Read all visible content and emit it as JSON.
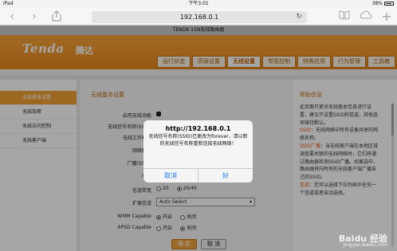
{
  "status_bar": {
    "carrier": "iPad",
    "time": "下午3:01",
    "battery": "38%"
  },
  "browser": {
    "url": "192.168.0.1"
  },
  "page_title": "TENDA 11N无线路由器",
  "header": {
    "logo": "Tenda",
    "logo_cn": "腾达",
    "nav_tabs": [
      "运行状态",
      "高级设置",
      "无线设置",
      "带宽控制",
      "特殊应用",
      "行为管理",
      "工具箱"
    ],
    "active_tab_index": 2
  },
  "sidebar": {
    "items": [
      {
        "label": "无线基本设置",
        "active": true
      },
      {
        "label": "无线加密",
        "active": false
      },
      {
        "label": "无线访问控制",
        "active": false
      },
      {
        "label": "无线客户端",
        "active": false
      }
    ]
  },
  "main": {
    "section_title": "无线基本设置",
    "labels": {
      "enable": "启用无线功能",
      "ssid": "无线信号名称(SSID)",
      "mode": "无线工作模式",
      "network_mode": "网络模式",
      "broadcast": "广播(SSID)",
      "channel": "信道",
      "bandwidth": "信道带宽",
      "ext_channel": "扩展信道",
      "wmm": "WMM Capable",
      "apsd": "APSD Capable"
    },
    "bandwidth_options": [
      "20",
      "20/40"
    ],
    "bandwidth_selected": "20/40",
    "ext_channel_value": "Auto Select",
    "wmm_options": [
      "开启",
      "关闭"
    ],
    "wmm_selected": "开启",
    "apsd_options": [
      "开启",
      "关闭"
    ],
    "apsd_selected": "关闭",
    "ok_button": "确 定",
    "cancel_button": "取 消"
  },
  "help": {
    "title": "帮助信息",
    "intro": "此页面只更对无线基本信息进行设置，建议只设置SSID和信道，其他选项保持默认。",
    "ssid_term": "SSID",
    "ssid_text": "：无线网络中所有设备共享的网络名称。",
    "ssid_bc_term": "SSID广播",
    "ssid_bc_text": "：当无线客户端在本地区域调查要关联的无线网络时，它们将通过路由器检测SSID广播。如果选中，路由器将向所有的无线客户端广播自己的SSID。",
    "channel_term": "信道",
    "channel_text": "：您可以选择下拉列表中任何一个信道或者自动选择。"
  },
  "dialog": {
    "title": "http://192.168.0.1",
    "message": "无线信号名称(SSID)已更改为forever，请以新的无线信号名称重新连接无线网络！",
    "cancel": "取消",
    "ok": "好"
  },
  "watermark": {
    "logo": "Baidu 经验",
    "url": "jingyan.baidu.com"
  }
}
